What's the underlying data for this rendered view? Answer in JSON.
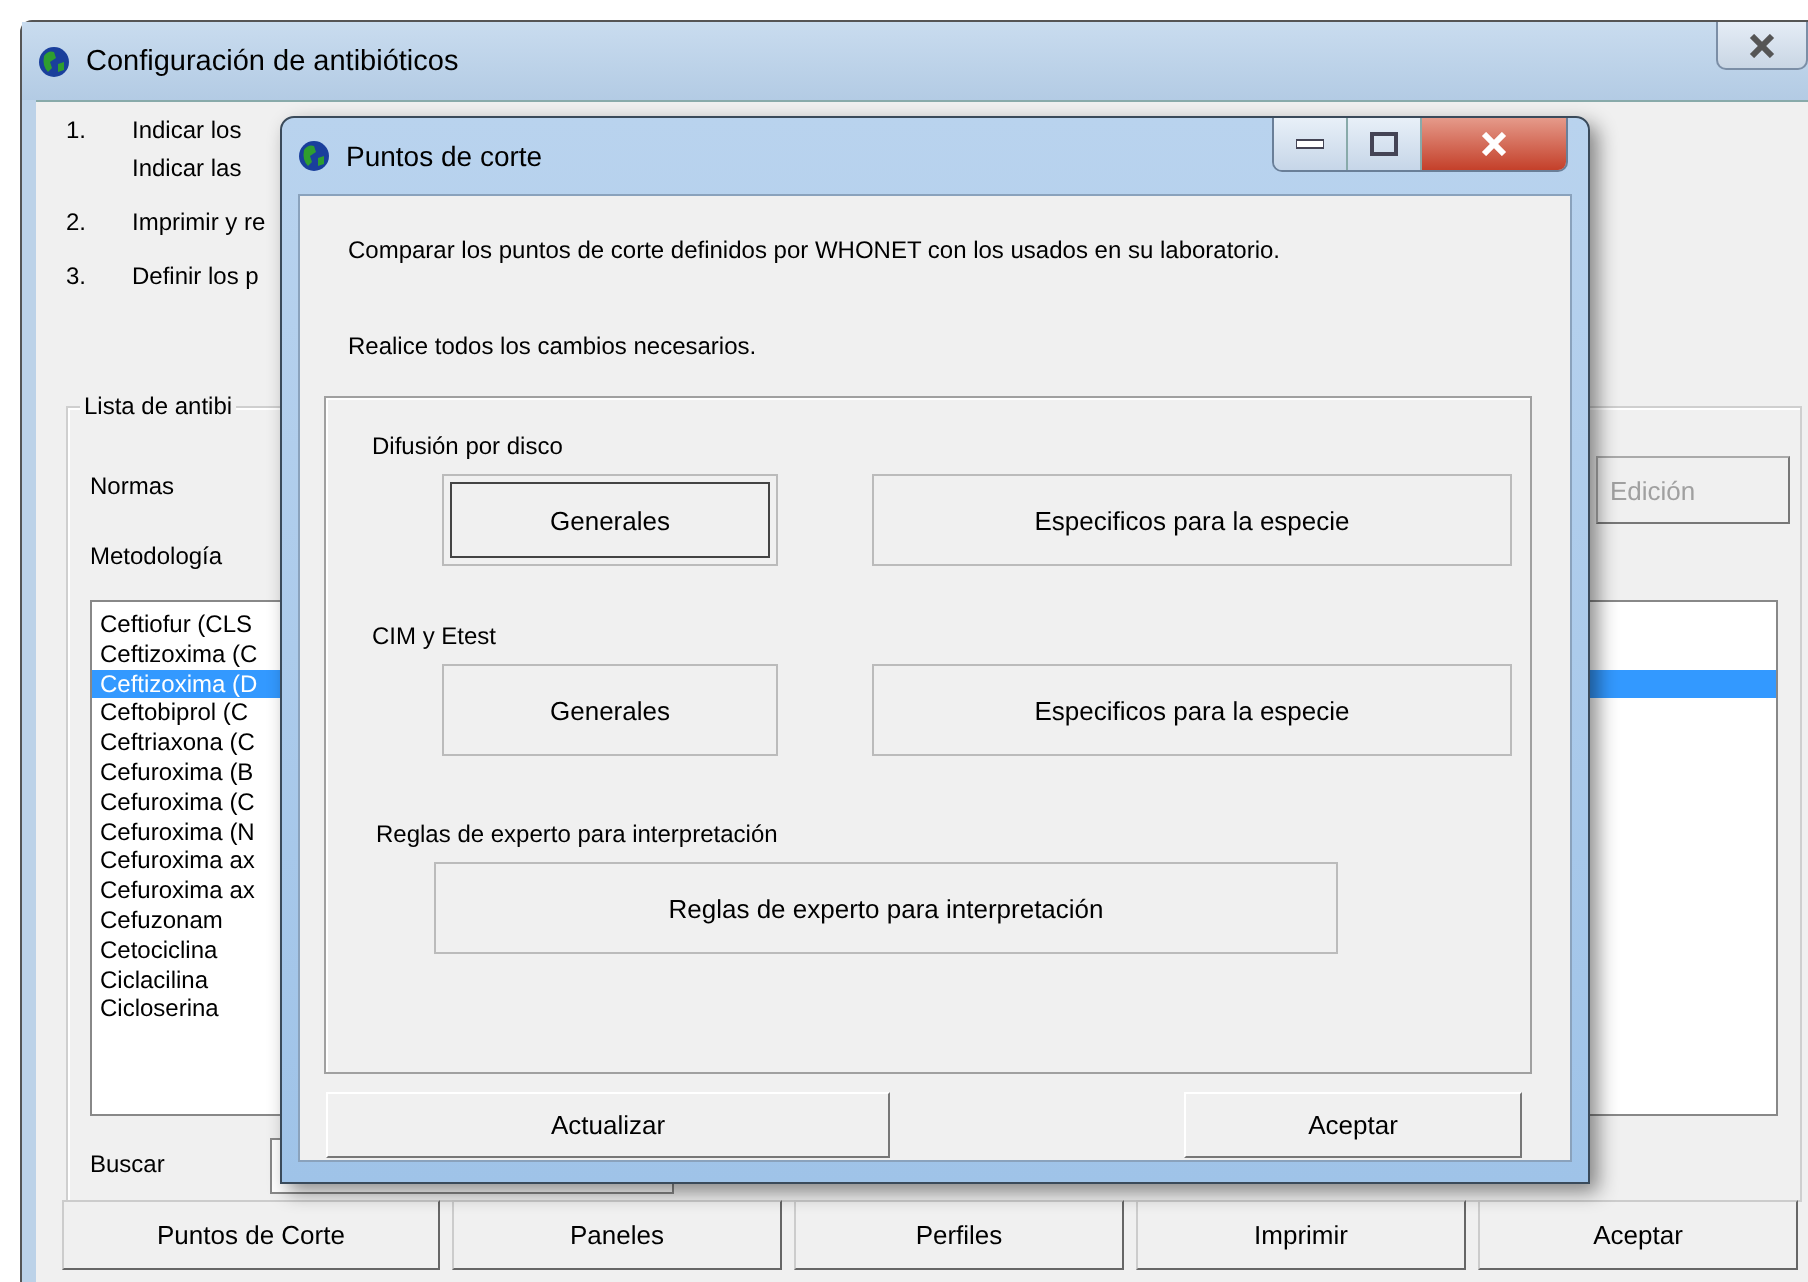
{
  "main_window": {
    "title": "Configuración de antibióticos",
    "steps": [
      {
        "number": "1.",
        "lines": [
          "Indicar los",
          "Indicar las"
        ]
      },
      {
        "number": "2.",
        "lines": [
          "Imprimir y re"
        ]
      },
      {
        "number": "3.",
        "lines": [
          "Definir los p"
        ]
      }
    ],
    "group": {
      "title": "Lista de antibi",
      "normas_label": "Normas",
      "edit_button": {
        "label": "Edición",
        "disabled": true
      },
      "metodologia_label": "Metodología",
      "antibiotics": [
        {
          "name": "Ceftiofur (CLS",
          "selected": false
        },
        {
          "name": "Ceftizoxima (C",
          "selected": false
        },
        {
          "name": "Ceftizoxima (D",
          "selected": true
        },
        {
          "name": "Ceftobiprol (C",
          "selected": false
        },
        {
          "name": "Ceftriaxona (C",
          "selected": false
        },
        {
          "name": "Cefuroxima (B",
          "selected": false
        },
        {
          "name": "Cefuroxima (C",
          "selected": false
        },
        {
          "name": "Cefuroxima (N",
          "selected": false
        },
        {
          "name": "Cefuroxima ax",
          "selected": false
        },
        {
          "name": "Cefuroxima ax",
          "selected": false
        },
        {
          "name": "Cefuzonam",
          "selected": false
        },
        {
          "name": "Cetociclina",
          "selected": false
        },
        {
          "name": "Ciclacilina",
          "selected": false
        },
        {
          "name": "Cicloserina",
          "selected": false
        }
      ],
      "search_label": "Buscar"
    },
    "buttons": [
      "Puntos de Corte",
      "Paneles",
      "Perfiles",
      "Imprimir",
      "Aceptar"
    ]
  },
  "dialog": {
    "title": "Puntos de corte",
    "intro": "Comparar los puntos de corte definidos por WHONET con los usados en su laboratorio.",
    "instruction": "Realice todos los cambios necesarios.",
    "sections": [
      {
        "title": "Difusión por disco",
        "buttons": [
          {
            "label": "Generales",
            "focused": true
          },
          {
            "label": "Especificos para la especie",
            "focused": false
          }
        ]
      },
      {
        "title": "CIM y Etest",
        "buttons": [
          {
            "label": "Generales",
            "focused": false
          },
          {
            "label": "Especificos para la especie",
            "focused": false
          }
        ]
      },
      {
        "title": "Reglas de experto para interpretación",
        "buttons": [
          {
            "label": "Reglas de experto para interpretación",
            "focused": false
          }
        ]
      }
    ],
    "buttons": [
      "Actualizar",
      "Aceptar"
    ]
  }
}
